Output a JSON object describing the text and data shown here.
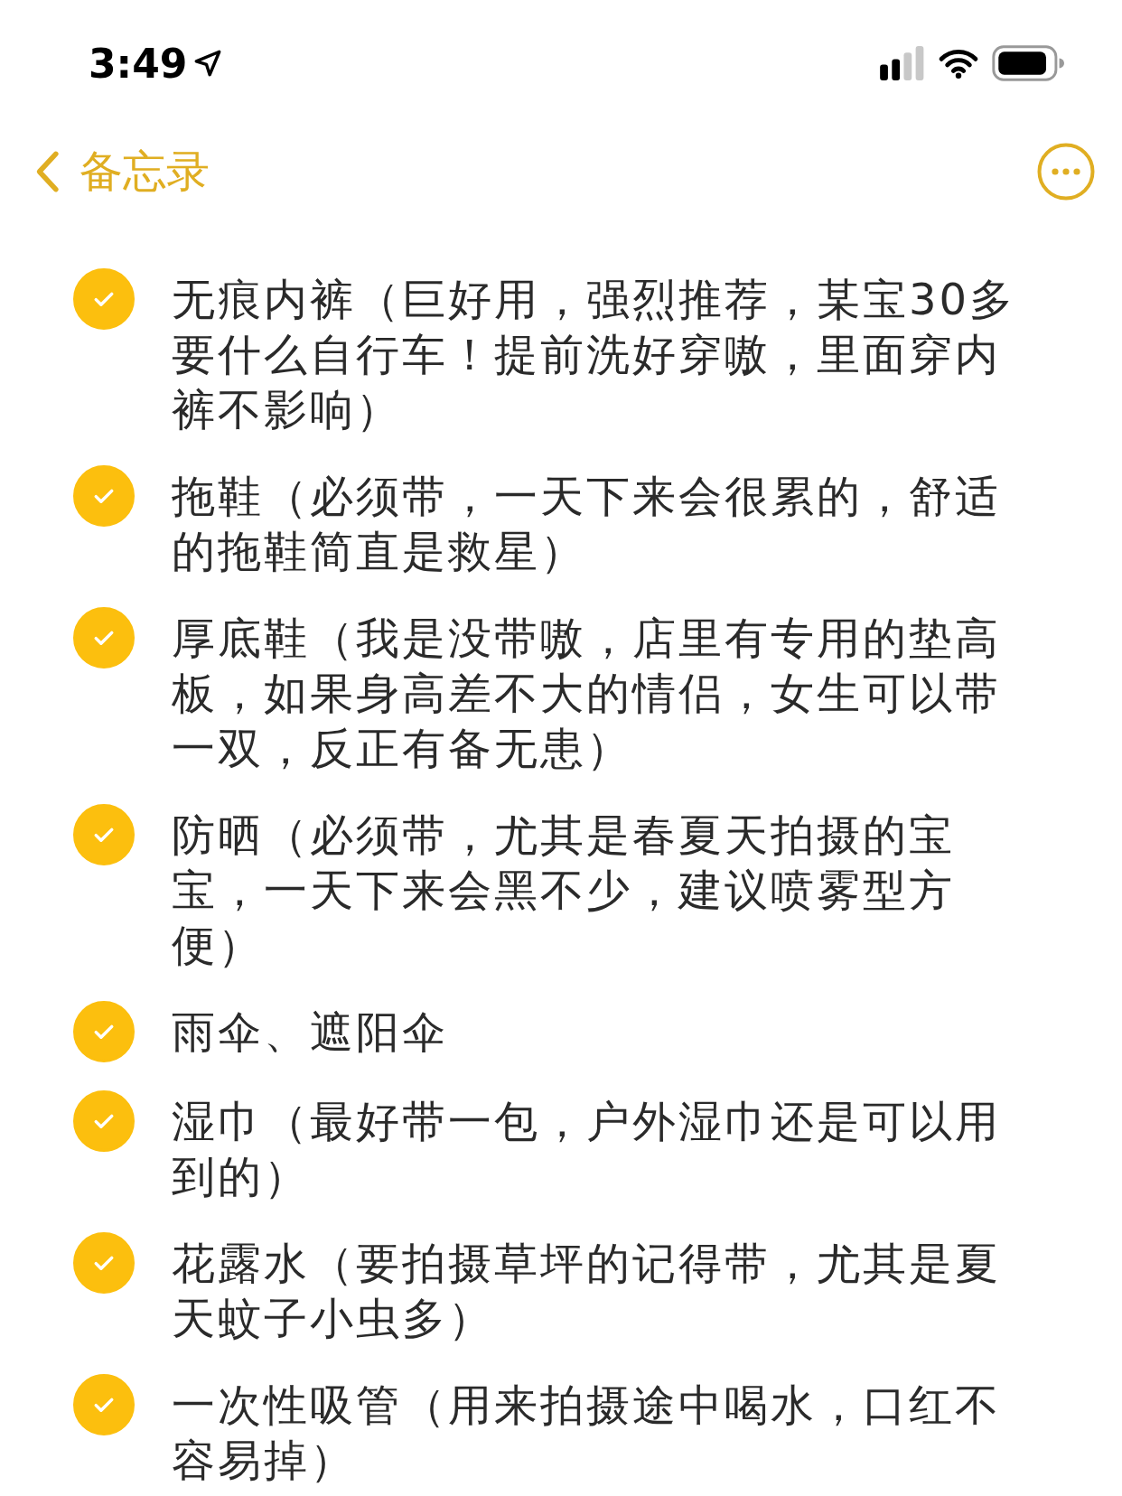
{
  "status_bar": {
    "time": "3:49"
  },
  "nav_bar": {
    "back_label": "备忘录"
  },
  "checklist": [
    {
      "text": "无痕内裤（巨好用，强烈推荐，某宝30多要什么自行车！提前洗好穿嗷，里面穿内裤不影响）",
      "checked": true
    },
    {
      "text": "拖鞋（必须带，一天下来会很累的，舒适的拖鞋简直是救星）",
      "checked": true
    },
    {
      "text": "厚底鞋（我是没带嗷，店里有专用的垫高板，如果身高差不大的情侣，女生可以带一双，反正有备无患）",
      "checked": true
    },
    {
      "text": "防晒（必须带，尤其是春夏天拍摄的宝宝，一天下来会黑不少，建议喷雾型方便）",
      "checked": true
    },
    {
      "text": "雨伞、遮阳伞",
      "checked": true
    },
    {
      "text": "湿巾（最好带一包，户外湿巾还是可以用到的）",
      "checked": true
    },
    {
      "text": "花露水（要拍摄草坪的记得带，尤其是夏天蚊子小虫多）",
      "checked": true
    },
    {
      "text": "一次性吸管（用来拍摄途中喝水，口红不容易掉）",
      "checked": true
    }
  ]
}
